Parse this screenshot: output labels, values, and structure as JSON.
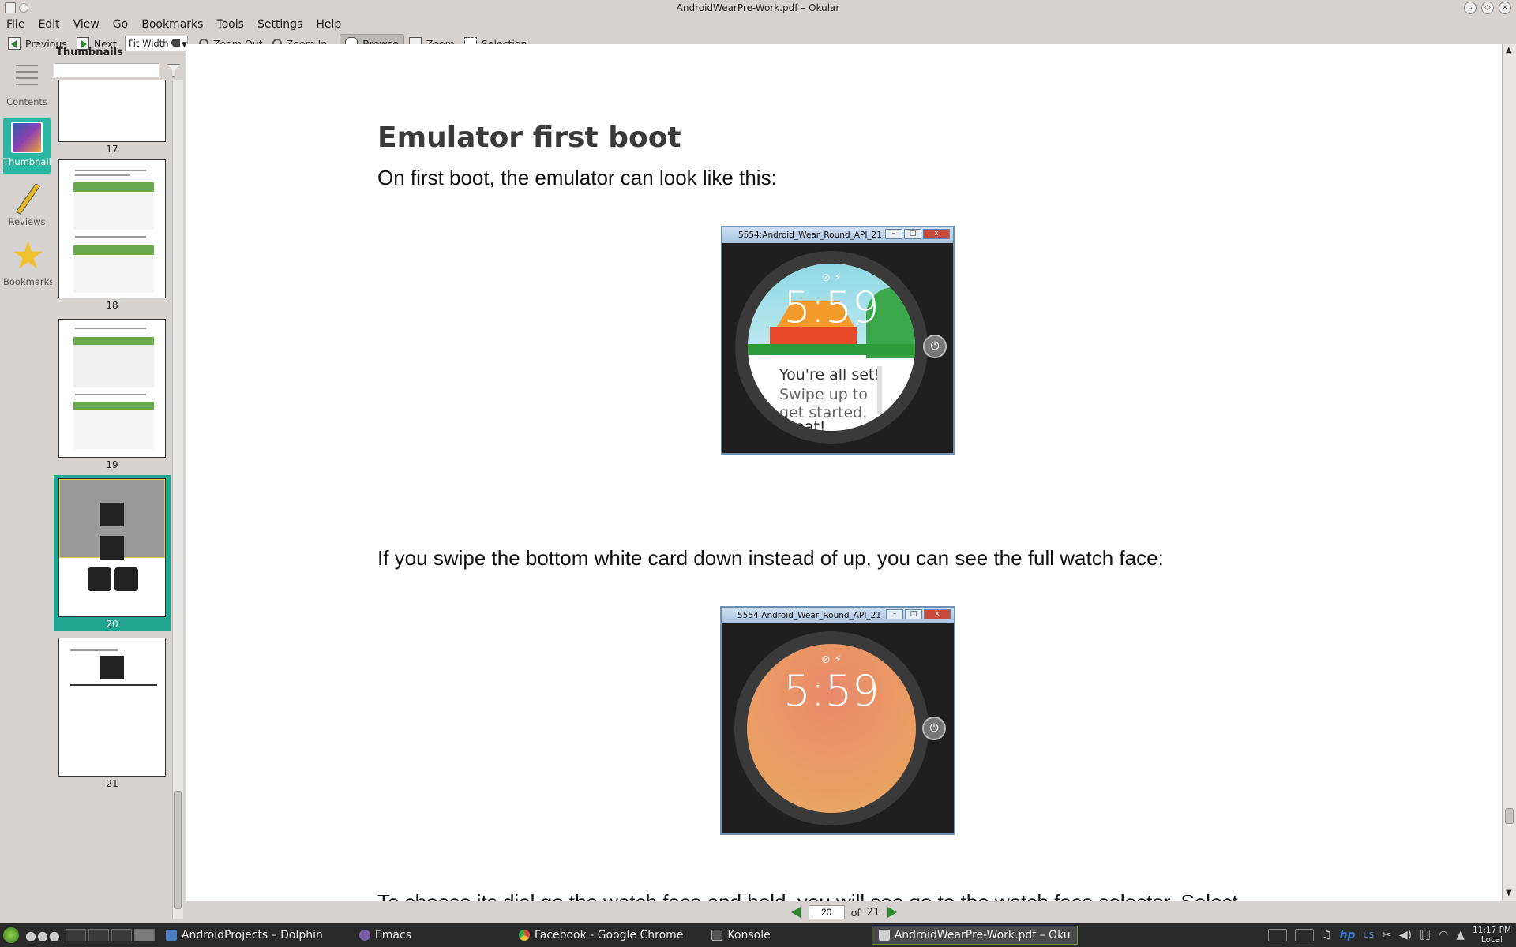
{
  "window": {
    "title": "AndroidWearPre-Work.pdf – Okular"
  },
  "menubar": {
    "items": [
      "File",
      "Edit",
      "View",
      "Go",
      "Bookmarks",
      "Tools",
      "Settings",
      "Help"
    ]
  },
  "toolbar": {
    "previous": "Previous",
    "next": "Next",
    "zoom_value": "Fit Width",
    "zoom_out": "Zoom Out",
    "zoom_in": "Zoom In",
    "browse": "Browse",
    "zoom": "Zoom",
    "selection": "Selection"
  },
  "sidebar": {
    "tabs": [
      {
        "label": "Contents",
        "icon": "contents-icon",
        "selected": false
      },
      {
        "label": "Thumbnails",
        "icon": "thumbnails-icon",
        "selected": true
      },
      {
        "label": "Reviews",
        "icon": "pencil-icon",
        "selected": false
      },
      {
        "label": "Bookmarks",
        "icon": "star-icon",
        "selected": false
      }
    ]
  },
  "thumbnails": {
    "header": "Thumbnails",
    "search_value": "",
    "pages": [
      "17",
      "18",
      "19",
      "20",
      "21"
    ],
    "current_page": "20",
    "accent": "#1fa58f"
  },
  "document": {
    "heading": "Emulator first boot",
    "para1": "On first boot, the emulator can look like this:",
    "para2": "If you swipe the bottom white card down instead of up, you can see the full watch face:",
    "para3_partial": "To choose its dial go the watch face and hold, you will see go to the watch face selector. Select",
    "emulator1": {
      "title": "5554:Android_Wear_Round_API_21",
      "time": "5:59",
      "status_icons": "⊘ ⚡",
      "card_title": "You're all set!",
      "card_sub": "Swipe up to get started.",
      "card_button": "Great!"
    },
    "emulator2": {
      "title": "5554:Android_Wear_Round_API_21",
      "time": "5:59",
      "status_icons": "⊘ ⚡"
    }
  },
  "pagenav": {
    "current": "20",
    "of_label": "of",
    "total": "21"
  },
  "taskbar": {
    "tasks": [
      {
        "label": "AndroidProjects – Dolphin",
        "color": "#4a7fc1"
      },
      {
        "label": "Emacs",
        "color": "#7a5fa8"
      },
      {
        "label": "Facebook - Google Chrome",
        "color": "#d8a020"
      },
      {
        "label": "Konsole",
        "color": "#555555"
      },
      {
        "label": "AndroidWearPre-Work.pdf – Oku",
        "color": "#d0d0d0"
      }
    ],
    "tray_lang": "US",
    "clock_time": "11:17 PM",
    "clock_zone": "Local"
  }
}
